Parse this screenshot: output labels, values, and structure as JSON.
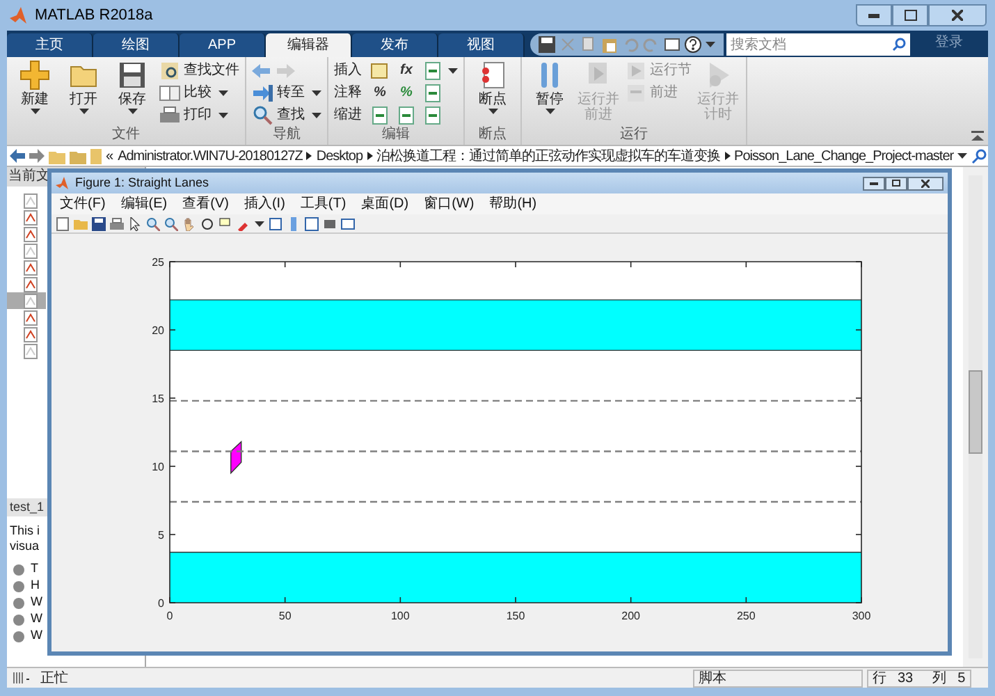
{
  "window": {
    "title": "MATLAB R2018a"
  },
  "tabs": [
    {
      "label": "主页",
      "selected": false
    },
    {
      "label": "绘图",
      "selected": false
    },
    {
      "label": "APP",
      "selected": false
    },
    {
      "label": "编辑器",
      "selected": true
    },
    {
      "label": "发布",
      "selected": false
    },
    {
      "label": "视图",
      "selected": false
    }
  ],
  "search": {
    "placeholder": "搜索文档"
  },
  "sign_in": "登录",
  "ribbon": {
    "groups": [
      {
        "label": "文件",
        "columns": [
          {
            "kind": "large",
            "label": "新建",
            "dropdown": true,
            "disabled": false
          },
          {
            "kind": "large",
            "label": "打开",
            "dropdown": true,
            "disabled": false
          },
          {
            "kind": "large",
            "label": "保存",
            "dropdown": true,
            "disabled": false
          },
          {
            "kind": "stack",
            "items": [
              {
                "label": "查找文件",
                "dropdown": false,
                "disabled": false
              },
              {
                "label": "比较",
                "dropdown": true,
                "disabled": false
              },
              {
                "label": "打印",
                "dropdown": true,
                "disabled": false
              }
            ]
          }
        ]
      },
      {
        "label": "导航",
        "columns": [
          {
            "kind": "stack",
            "items": [
              {
                "kind": "arrows"
              },
              {
                "label": "转至",
                "dropdown": true,
                "disabled": false
              },
              {
                "label": "查找",
                "dropdown": true,
                "disabled": false
              }
            ]
          }
        ]
      },
      {
        "label": "编辑",
        "columns": [
          {
            "kind": "rows",
            "rows": [
              {
                "label": "插入",
                "glyphs": [
                  "fx"
                ]
              },
              {
                "label": "注释",
                "glyphs": [
                  "%",
                  "%"
                ]
              },
              {
                "label": "缩进"
              }
            ]
          }
        ]
      },
      {
        "label": "断点",
        "columns": [
          {
            "kind": "large",
            "label": "断点",
            "dropdown": true,
            "disabled": false
          }
        ]
      },
      {
        "label": "运行",
        "columns": [
          {
            "kind": "large",
            "label": "暂停",
            "dropdown": true,
            "disabled": false
          },
          {
            "kind": "large",
            "label": "运行并前进",
            "dropdown": false,
            "disabled": true
          },
          {
            "kind": "stack",
            "items": [
              {
                "label": "运行节",
                "dropdown": false,
                "disabled": true
              },
              {
                "label": "前进",
                "dropdown": false,
                "disabled": true
              }
            ]
          },
          {
            "kind": "large",
            "label": "运行并计时",
            "dropdown": false,
            "disabled": true
          }
        ]
      }
    ]
  },
  "address": {
    "prefix": "«",
    "segments": [
      "Administrator.WIN7U-20180127Z",
      "Desktop",
      "泊松换道工程：通过简单的正弦动作实现虚拟车的车道变换",
      "Poisson_Lane_Change_Project-master"
    ]
  },
  "current_folder": {
    "title": "当前文",
    "files": [
      {
        "selected": false
      },
      {
        "selected": false
      },
      {
        "selected": false
      },
      {
        "selected": false
      },
      {
        "selected": false
      },
      {
        "selected": false
      },
      {
        "selected": true
      },
      {
        "selected": false
      },
      {
        "selected": false
      },
      {
        "selected": false
      }
    ]
  },
  "details": {
    "title": "test_1",
    "lines": [
      "This i",
      "visua"
    ],
    "items": [
      "T",
      "H",
      "W",
      "W",
      "W"
    ]
  },
  "figure": {
    "title": "Figure 1: Straight Lanes",
    "menu": [
      "文件(F)",
      "编辑(E)",
      "查看(V)",
      "插入(I)",
      "工具(T)",
      "桌面(D)",
      "窗口(W)",
      "帮助(H)"
    ],
    "chart_data": {
      "type": "line",
      "x": [
        0,
        300
      ],
      "series": [
        {
          "color": "#808080",
          "line_style": "dashed",
          "values": [
            7.4,
            7.4
          ]
        },
        {
          "color": "#808080",
          "line_style": "dashed",
          "values": [
            11.1,
            11.1
          ]
        },
        {
          "color": "#808080",
          "line_style": "dashed",
          "values": [
            14.8,
            14.8
          ]
        }
      ],
      "xlim": [
        0,
        300
      ],
      "ylim": [
        0,
        25
      ],
      "xticks": [
        0,
        50,
        100,
        150,
        200,
        250,
        300
      ],
      "yticks": [
        0,
        5,
        10,
        15,
        20,
        25
      ]
    }
  },
  "status_bar": {
    "state": "正忙",
    "file_type": "脚本",
    "line_label": "行",
    "line": "33",
    "column_label": "列",
    "column": "5"
  }
}
